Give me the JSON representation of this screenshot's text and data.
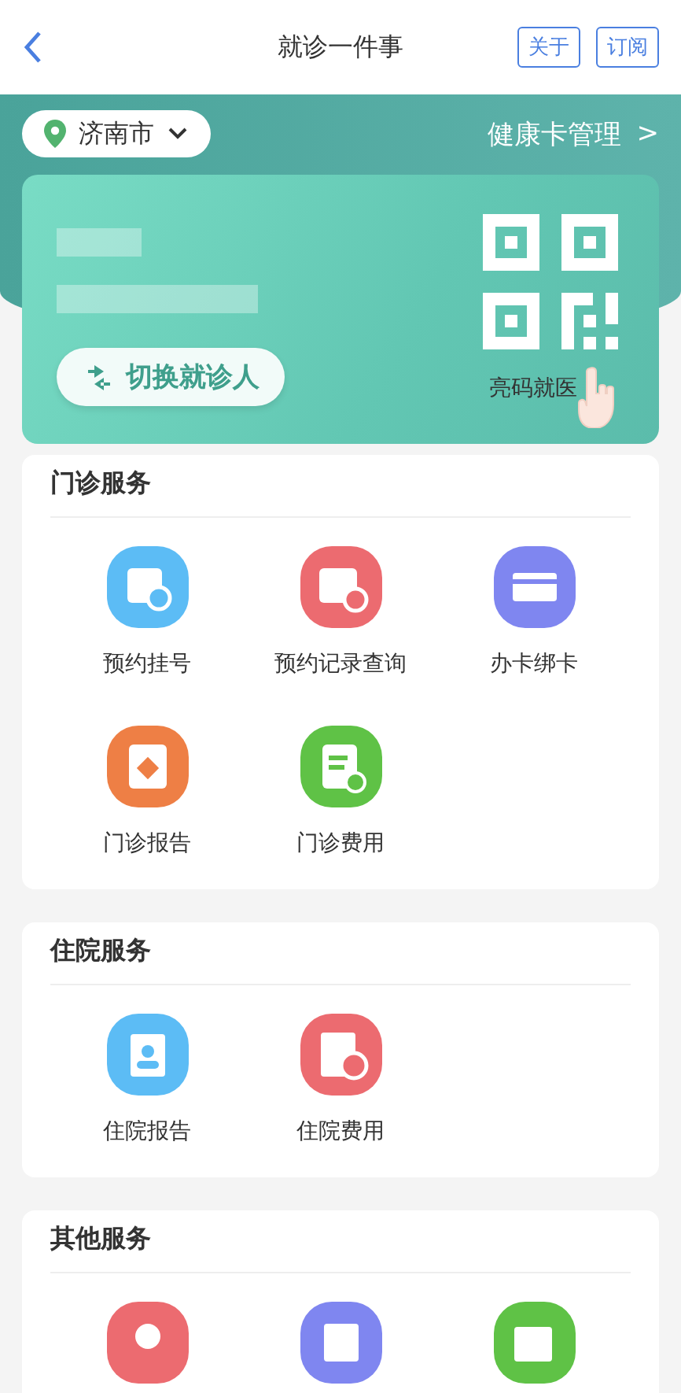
{
  "nav": {
    "title": "就诊一件事",
    "actions": [
      "关于",
      "订阅"
    ]
  },
  "location": {
    "city": "济南市"
  },
  "card_manage": {
    "label": "健康卡管理",
    "arrow": ">"
  },
  "card": {
    "switch_label": "切换就诊人",
    "qr_label": "亮码就医"
  },
  "sections": [
    {
      "title": "门诊服务",
      "items": [
        {
          "label": "预约挂号",
          "kind": "schedule",
          "color": "#5cbcf5"
        },
        {
          "label": "预约记录查询",
          "kind": "record",
          "color": "#ec6b70"
        },
        {
          "label": "办卡绑卡",
          "kind": "card",
          "color": "#7f86f0"
        },
        {
          "label": "门诊报告",
          "kind": "report",
          "color": "#ee7f45"
        },
        {
          "label": "门诊费用",
          "kind": "fee",
          "color": "#5fc246"
        }
      ]
    },
    {
      "title": "住院服务",
      "items": [
        {
          "label": "住院报告",
          "kind": "badge",
          "color": "#5cbcf5"
        },
        {
          "label": "住院费用",
          "kind": "bill",
          "color": "#ec6b70"
        }
      ]
    },
    {
      "title": "其他服务",
      "items": [
        {
          "kind": "pin",
          "color": "#ec6b70"
        },
        {
          "kind": "doc",
          "color": "#7f86f0"
        },
        {
          "kind": "edit",
          "color": "#5fc246"
        }
      ]
    }
  ]
}
